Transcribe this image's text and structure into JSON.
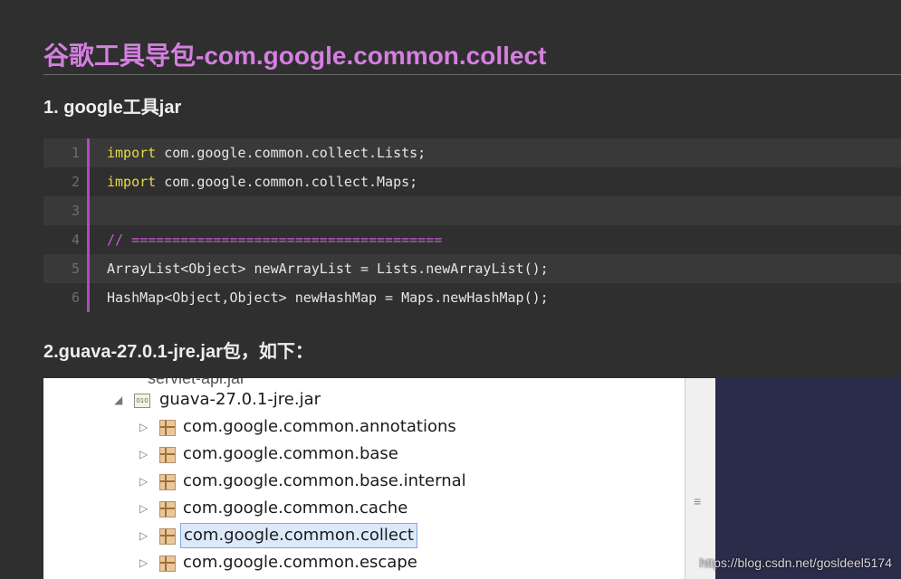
{
  "article": {
    "title": "谷歌工具导包-com.google.common.collect",
    "heading1": "1. google工具jar",
    "heading2": "2.guava-27.0.1-jre.jar包，如下："
  },
  "code": {
    "lines": [
      {
        "num": "1",
        "keyword": "import",
        "rest": " com.google.common.collect.Lists;"
      },
      {
        "num": "2",
        "keyword": "import",
        "rest": " com.google.common.collect.Maps;"
      },
      {
        "num": "3",
        "text": ""
      },
      {
        "num": "4",
        "comment": "// ======================================"
      },
      {
        "num": "5",
        "text": "ArrayList<Object> newArrayList = Lists.newArrayList();"
      },
      {
        "num": "6",
        "text": "HashMap<Object,Object> newHashMap = Maps.newHashMap();"
      }
    ]
  },
  "screenshot": {
    "cut_text": "servlet-api.jar",
    "jar_label": "guava-27.0.1-jre.jar",
    "jar_icon_text": "010",
    "packages": [
      "com.google.common.annotations",
      "com.google.common.base",
      "com.google.common.base.internal",
      "com.google.common.cache",
      "com.google.common.collect",
      "com.google.common.escape"
    ],
    "selected_index": 4
  },
  "watermark": "https://blog.csdn.net/gosldeel5174"
}
